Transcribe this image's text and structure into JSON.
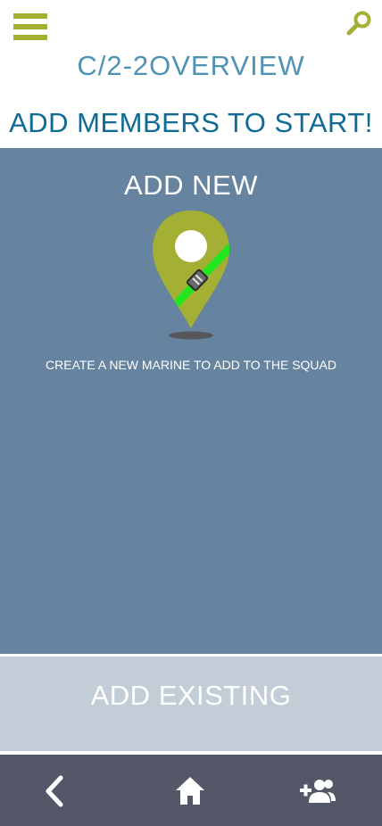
{
  "header": {
    "title": "C/2-2OVERVIEW",
    "subtitle": "ADD MEMBERS TO START!"
  },
  "add_new": {
    "title_prefix": "ADD ",
    "title_emphasis": "NEW",
    "description": "CREATE A NEW MARINE TO ADD TO THE SQUAD"
  },
  "add_existing": {
    "title_prefix": "ADD ",
    "title_emphasis": "EXISTING"
  },
  "icons": {
    "menu": "hamburger-menu-icon",
    "search": "search-icon",
    "pin": "map-pin-icon",
    "back": "chevron-left-icon",
    "home": "home-icon",
    "add_user": "person-add-icon"
  },
  "colors": {
    "accent": "#a3b034",
    "title": "#4f93b4",
    "subtitle": "#0f6a96",
    "add_new_bg": "#66839f",
    "add_existing_bg": "#c3cdd7",
    "nav_bg": "#535768",
    "strap": "#22e61e"
  }
}
